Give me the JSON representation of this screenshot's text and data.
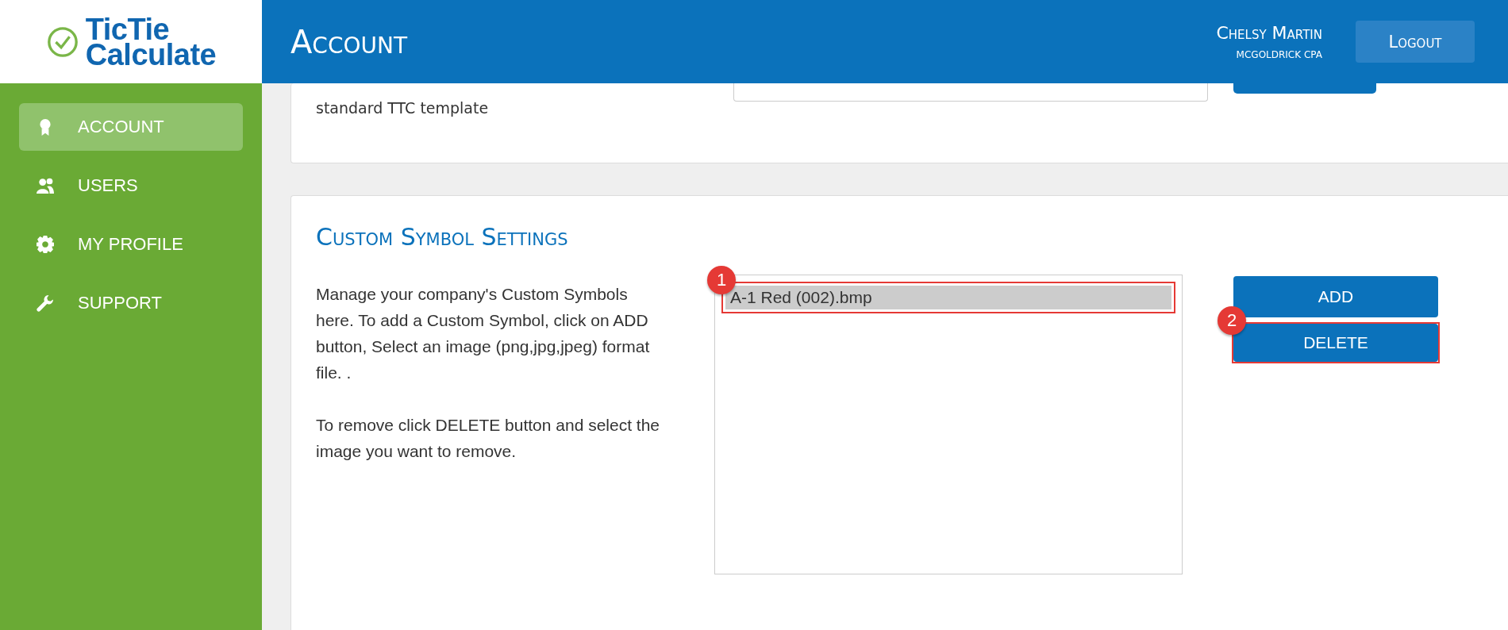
{
  "logo": {
    "line_1": "TicTie",
    "line_2": "Calculate"
  },
  "header": {
    "title": "Account",
    "user_name": "Chelsy Martin",
    "company": "MCGOLDRICK CPA",
    "logout": "Logout"
  },
  "sidebar": {
    "items": [
      {
        "label": "ACCOUNT",
        "kind": "award",
        "selected": true
      },
      {
        "label": "USERS",
        "kind": "users",
        "selected": false
      },
      {
        "label": "MY PROFILE",
        "kind": "gear",
        "selected": false
      },
      {
        "label": "SUPPORT",
        "kind": "wrench",
        "selected": false
      }
    ]
  },
  "template_card": {
    "text": "standard TTC template"
  },
  "symbol_card": {
    "title": "Custom Symbol Settings",
    "paragraphs": [
      "Manage your company's Custom Symbols here. To add a Custom Symbol, click on ADD button, Select an image (png,jpg,jpeg) format file. .",
      "To remove click DELETE button and select the image you want to remove."
    ],
    "items": [
      {
        "label": "A-1 Red (002).bmp",
        "selected": true,
        "callout": "1"
      }
    ],
    "buttons": [
      {
        "label": "ADD"
      },
      {
        "label": "DELETE",
        "callout": "2"
      }
    ]
  }
}
